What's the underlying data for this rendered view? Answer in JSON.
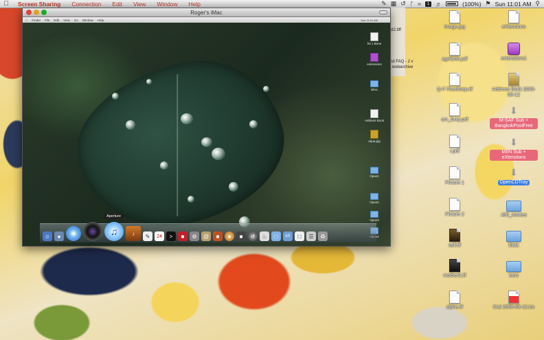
{
  "menubar": {
    "app_name": "Screen Sharing",
    "items": [
      "Connection",
      "Edit",
      "View",
      "Window",
      "Help"
    ],
    "battery_text": "(100%)",
    "clock": "Sun 11:01 AM"
  },
  "remote_window": {
    "title": "Roger's iMac",
    "remote_menu": [
      "Finder",
      "File",
      "Edit",
      "View",
      "Go",
      "Window",
      "Help"
    ],
    "remote_clock": "Sun 11:01 AM",
    "dock_tooltip": "Aperture",
    "remote_desktop_icons": [
      "fst 1 Bone",
      "extensions",
      "Bliss",
      "Address Book",
      "aqua.jpg",
      "Opus1",
      "Opus2",
      "Opus3",
      "Opus4"
    ]
  },
  "background_window": {
    "fragments": [
      "st2.tiff",
      "nd FAQ - 2 v",
      "l.webarchive"
    ]
  },
  "desktop_icons": [
    {
      "label": "image.jpg",
      "type": "doc"
    },
    {
      "label": "eXtensions",
      "type": "doc"
    },
    {
      "label": "agrif250.pdf",
      "type": "doc"
    },
    {
      "label": "extensions1",
      "type": "purple"
    },
    {
      "label": "Q-F FixedMap.tif",
      "type": "doc"
    },
    {
      "label": "Address Book 2008-08-12",
      "type": "gold"
    },
    {
      "label": "am_bxxy.pdf",
      "type": "doc"
    },
    {
      "label": "M-SAF Sub + BangkokPostFree",
      "type": "download",
      "style": "pink"
    },
    {
      "label": "r.pdf",
      "type": "doc"
    },
    {
      "label": "MIIN Sub + eXtensions",
      "type": "download",
      "style": "pink"
    },
    {
      "label": "Picture 1",
      "type": "doc"
    },
    {
      "label": "OpenCDTray",
      "type": "download",
      "style": "blue"
    },
    {
      "label": "Picture 2",
      "type": "doc"
    },
    {
      "label": "490_movies",
      "type": "folder"
    },
    {
      "label": "sail.tif",
      "type": "dark"
    },
    {
      "label": "blatz",
      "type": "folder"
    },
    {
      "label": "mother2.tif",
      "type": "dark2"
    },
    {
      "label": "tans",
      "type": "folder"
    },
    {
      "label": "alpha.tif",
      "type": "doc"
    },
    {
      "label": "iCal 2008-08-12.ics",
      "type": "doc"
    }
  ],
  "colors": {
    "menu_accent": "#c0392b",
    "pink_label": "#e8687a",
    "blue_label": "#3d7ee0"
  }
}
